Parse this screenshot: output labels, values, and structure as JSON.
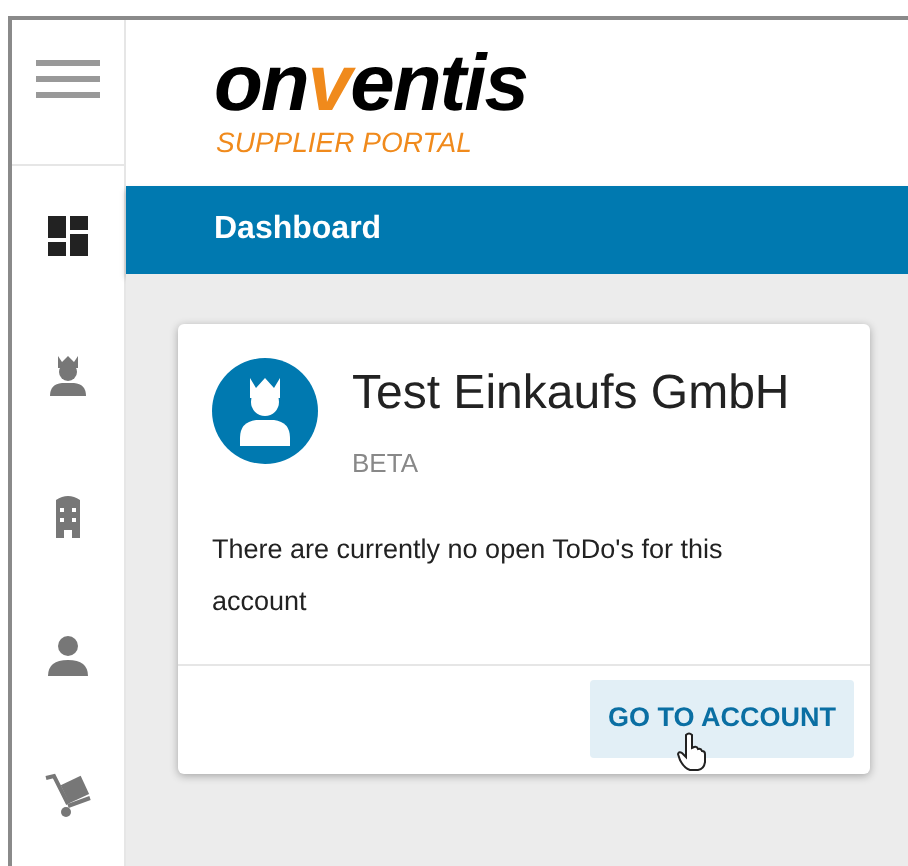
{
  "logo": {
    "wordmark": "onventis",
    "subtitle": "SUPPLIER PORTAL"
  },
  "sidebar": {
    "items": [
      {
        "kind": "dashboard",
        "selected": true
      },
      {
        "kind": "crowned-user",
        "selected": false
      },
      {
        "kind": "building",
        "selected": false
      },
      {
        "kind": "user",
        "selected": false
      },
      {
        "kind": "hand-truck",
        "selected": false
      }
    ]
  },
  "title_bar": {
    "title": "Dashboard"
  },
  "card": {
    "title": "Test Einkaufs GmbH",
    "badge": "BETA",
    "message": "There are currently no open ToDo's for this account",
    "button": "GO TO ACCOUNT"
  }
}
